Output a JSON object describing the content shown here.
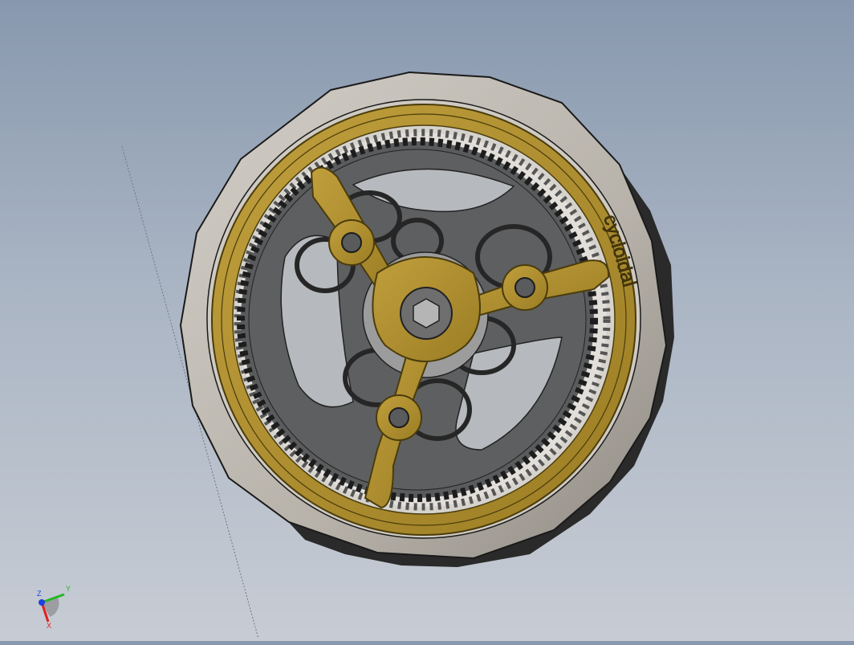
{
  "viewport": {
    "background_top": "#8898ae",
    "background_bottom": "#c7ccd4"
  },
  "model": {
    "engraved_text": "cycloidal",
    "colors": {
      "housing": "#b9b4ac",
      "housing_shadow": "#2a2a2a",
      "output_plate": "#b08f2f",
      "output_plate_edge": "#4a3c0c",
      "gear": "#5a5b5c",
      "gear_edge": "#1d1d1d",
      "hub": "#9c9c9c"
    }
  },
  "triad": {
    "x_label": "X",
    "y_label": "Y",
    "z_label": "Z",
    "x_color": "#e02020",
    "y_color": "#22b822",
    "z_color": "#2040e0"
  }
}
